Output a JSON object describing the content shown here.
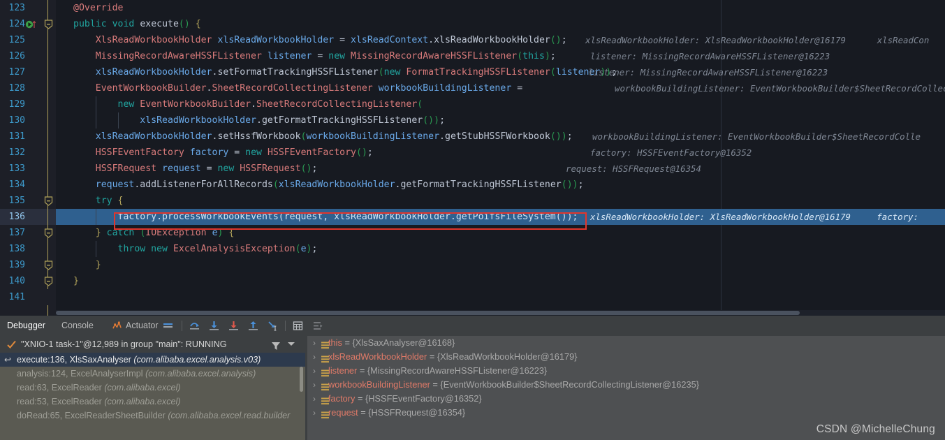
{
  "editor": {
    "lines": [
      {
        "num": "123",
        "indent": 0,
        "code": "@Override",
        "hint": ""
      },
      {
        "num": "124",
        "indent": 0,
        "code": "public void execute() {",
        "hint": "",
        "run_icon": true,
        "fold": "collapse"
      },
      {
        "num": "125",
        "indent": 1,
        "code": "XlsReadWorkbookHolder xlsReadWorkbookHolder = xlsReadContext.xlsReadWorkbookHolder();",
        "hint": "xlsReadWorkbookHolder: XlsReadWorkbookHolder@16179      xlsReadCon"
      },
      {
        "num": "126",
        "indent": 1,
        "code": "MissingRecordAwareHSSFListener listener = new MissingRecordAwareHSSFListener(this);",
        "hint": "listener: MissingRecordAwareHSSFListener@16223"
      },
      {
        "num": "127",
        "indent": 1,
        "code": "xlsReadWorkbookHolder.setFormatTrackingHSSFListener(new FormatTrackingHSSFListener(listener));",
        "hint": "listener: MissingRecordAwareHSSFListener@16223"
      },
      {
        "num": "128",
        "indent": 1,
        "code": "EventWorkbookBuilder.SheetRecordCollectingListener workbookBuildingListener =",
        "hint": "workbookBuildingListener: EventWorkbookBuilder$SheetRecordCollectingList"
      },
      {
        "num": "129",
        "indent": 2,
        "code": "new EventWorkbookBuilder.SheetRecordCollectingListener(",
        "hint": ""
      },
      {
        "num": "130",
        "indent": 3,
        "code": "xlsReadWorkbookHolder.getFormatTrackingHSSFListener());",
        "hint": ""
      },
      {
        "num": "131",
        "indent": 1,
        "code": "xlsReadWorkbookHolder.setHssfWorkbook(workbookBuildingListener.getStubHSSFWorkbook());",
        "hint": "workbookBuildingListener: EventWorkbookBuilder$SheetRecordColle"
      },
      {
        "num": "132",
        "indent": 1,
        "code": "HSSFEventFactory factory = new HSSFEventFactory();",
        "hint": "factory: HSSFEventFactory@16352"
      },
      {
        "num": "133",
        "indent": 1,
        "code": "HSSFRequest request = new HSSFRequest();",
        "hint": "request: HSSFRequest@16354"
      },
      {
        "num": "134",
        "indent": 1,
        "code": "request.addListenerForAllRecords(xlsReadWorkbookHolder.getFormatTrackingHSSFListener());",
        "hint": ""
      },
      {
        "num": "135",
        "indent": 1,
        "code": "try {",
        "hint": "",
        "fold": "collapse"
      },
      {
        "num": "136",
        "indent": 2,
        "code": "factory.processWorkbookEvents(request, xlsReadWorkbookHolder.getPoifsFileSystem());",
        "hint": "xlsReadWorkbookHolder: XlsReadWorkbookHolder@16179     factory:",
        "current": true,
        "boxed": true
      },
      {
        "num": "137",
        "indent": 1,
        "code": "} catch (IOException e) {",
        "hint": "",
        "fold": "collapse"
      },
      {
        "num": "138",
        "indent": 2,
        "code": "throw new ExcelAnalysisException(e);",
        "hint": ""
      },
      {
        "num": "139",
        "indent": 1,
        "code": "}",
        "hint": "",
        "fold": "collapse"
      },
      {
        "num": "140",
        "indent": 0,
        "code": "}",
        "hint": "",
        "fold": "collapse"
      },
      {
        "num": "141",
        "indent": 0,
        "code": "",
        "hint": ""
      }
    ],
    "current_line": "136",
    "colors": {
      "background": "#171a21",
      "gutter": "#1d1f27",
      "line_number": "#3d9acb",
      "keyword": "#21a5a0",
      "class_name": "#d97b7b",
      "identifier": "#6aa9e9",
      "paren": "#2a9b52",
      "brace": "#b2a35a",
      "inline_hint": "#7f8794",
      "current_line_bg": "#2f608f",
      "highlight_box": "#e2362c"
    }
  },
  "debug_panel": {
    "tabs": [
      {
        "label": "Debugger",
        "active": true
      },
      {
        "label": "Console",
        "active": false
      },
      {
        "label": "Actuator",
        "active": false,
        "icon": "actuator-icon"
      }
    ],
    "toolbar": [
      {
        "name": "show-execution-point-icon",
        "title": "Show Execution Point"
      },
      {
        "name": "step-over-icon",
        "title": "Step Over"
      },
      {
        "name": "step-into-icon",
        "title": "Step Into"
      },
      {
        "name": "force-step-into-icon",
        "title": "Force Step Into"
      },
      {
        "name": "step-out-icon",
        "title": "Step Out"
      },
      {
        "name": "run-to-cursor-icon",
        "title": "Run to Cursor"
      },
      {
        "name": "evaluate-expression-icon",
        "title": "Evaluate Expression"
      },
      {
        "name": "mute-breakpoints-icon",
        "title": "Mute Breakpoints"
      }
    ],
    "frames": {
      "thread": "\"XNIO-1 task-1\"@12,989 in group \"main\": RUNNING",
      "filter_icon": "funnel-icon",
      "dropdown_icon": "chevron-down-icon",
      "items": [
        {
          "frame": "execute:136, XlsSaxAnalyser",
          "pkg": "(com.alibaba.excel.analysis.v03)",
          "selected": true
        },
        {
          "frame": "analysis:124, ExcelAnalyserImpl",
          "pkg": "(com.alibaba.excel.analysis)",
          "selected": false
        },
        {
          "frame": "read:63, ExcelReader",
          "pkg": "(com.alibaba.excel)",
          "selected": false
        },
        {
          "frame": "read:53, ExcelReader",
          "pkg": "(com.alibaba.excel)",
          "selected": false
        },
        {
          "frame": "doRead:65, ExcelReaderSheetBuilder",
          "pkg": "(com.alibaba.excel.read.builder",
          "selected": false
        }
      ]
    },
    "variables": [
      {
        "name": "this",
        "eq": " = ",
        "value": "{XlsSaxAnalyser@16168}"
      },
      {
        "name": "xlsReadWorkbookHolder",
        "eq": " = ",
        "value": "{XlsReadWorkbookHolder@16179}"
      },
      {
        "name": "listener",
        "eq": " = ",
        "value": "{MissingRecordAwareHSSFListener@16223}"
      },
      {
        "name": "workbookBuildingListener",
        "eq": " = ",
        "value": "{EventWorkbookBuilder$SheetRecordCollectingListener@16235}"
      },
      {
        "name": "factory",
        "eq": " = ",
        "value": "{HSSFEventFactory@16352}"
      },
      {
        "name": "request",
        "eq": " = ",
        "value": "{HSSFRequest@16354}"
      }
    ]
  },
  "watermark": "CSDN @MichelleChung"
}
